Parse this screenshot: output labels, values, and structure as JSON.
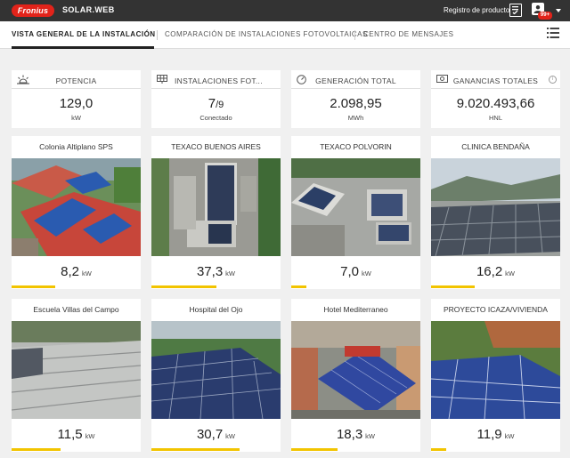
{
  "app": {
    "brand": "Fronius",
    "name": "SOLAR.WEB",
    "register_label": "Registro de producto",
    "notifications": "99+"
  },
  "tabs": [
    {
      "label": "VISTA GENERAL DE LA INSTALACIÓN",
      "active": true
    },
    {
      "label": "COMPARACIÓN DE INSTALACIONES FOTOVOLTAICAS",
      "active": false
    },
    {
      "label": "CENTRO DE MENSAJES",
      "active": false
    }
  ],
  "kpis": [
    {
      "title": "POTENCIA",
      "value": "129,0",
      "unit": "kW",
      "icon": "sun-icon"
    },
    {
      "title": "INSTALACIONES FOT...",
      "value_main": "7",
      "value_total": "9",
      "unit": "Conectado",
      "icon": "solar-panel-icon"
    },
    {
      "title": "GENERACIÓN TOTAL",
      "value": "2.098,95",
      "unit": "MWh",
      "icon": "gauge-icon"
    },
    {
      "title": "GANANCIAS TOTALES",
      "value": "9.020.493,66",
      "unit": "HNL",
      "icon": "money-icon"
    }
  ],
  "plants": [
    {
      "name": "Colonia Altiplano SPS",
      "value": "8,2",
      "unit": "kW",
      "level": 0.34
    },
    {
      "name": "TEXACO BUENOS AIRES",
      "value": "37,3",
      "unit": "kW",
      "level": 0.5
    },
    {
      "name": "TEXACO POLVORIN",
      "value": "7,0",
      "unit": "kW",
      "level": 0.12
    },
    {
      "name": "CLINICA BENDAÑA",
      "value": "16,2",
      "unit": "kW",
      "level": 0.34
    },
    {
      "name": "Escuela Villas del Campo",
      "value": "11,5",
      "unit": "kW",
      "level": 0.38
    },
    {
      "name": "Hospital del Ojo",
      "value": "30,7",
      "unit": "kW",
      "level": 0.68
    },
    {
      "name": "Hotel Mediterraneo",
      "value": "18,3",
      "unit": "kW",
      "level": 0.36
    },
    {
      "name": "PROYECTO ICAZA/VIVIENDA",
      "value": "11,9",
      "unit": "kW",
      "level": 0.12
    }
  ],
  "colors": {
    "topbar": "#333333",
    "brand": "#e2231a",
    "accent": "#f2c400"
  }
}
